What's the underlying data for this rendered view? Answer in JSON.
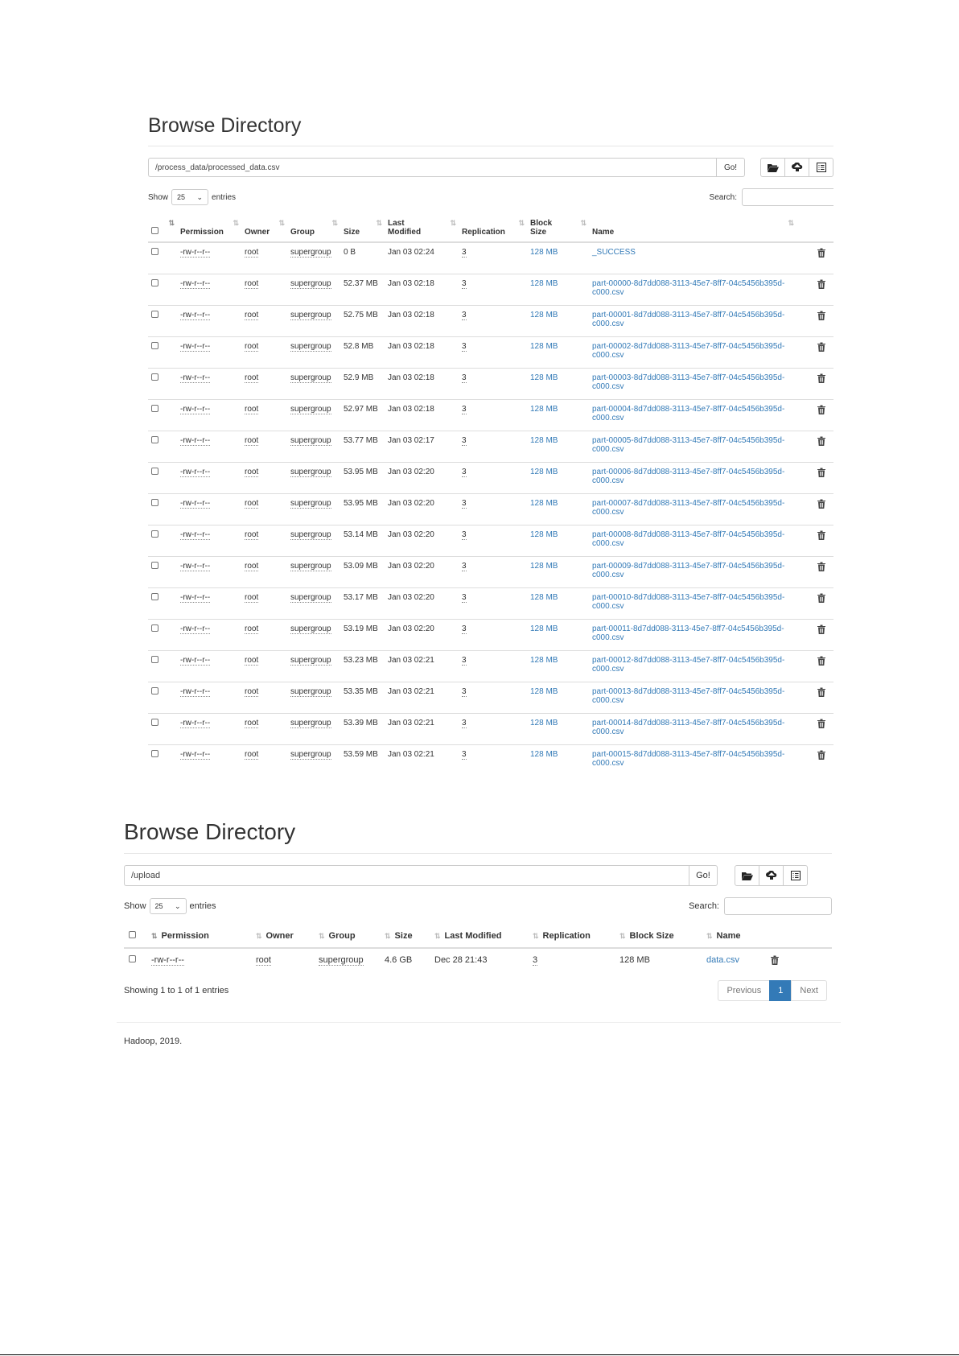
{
  "panel1": {
    "title": "Browse Directory",
    "path": "/process_data/processed_data.csv",
    "go_label": "Go!",
    "show_label": "Show",
    "entries_value": "25",
    "entries_label": "entries",
    "search_label": "Search:",
    "headers": [
      "Permission",
      "Owner",
      "Group",
      "Size",
      "Last Modified",
      "Replication",
      "Block Size",
      "Name"
    ],
    "rows": [
      [
        "-rw-r--r--",
        "root",
        "supergroup",
        "0 B",
        "Jan 03 02:24",
        "3",
        "128 MB",
        "_SUCCESS"
      ],
      [
        "-rw-r--r--",
        "root",
        "supergroup",
        "52.37 MB",
        "Jan 03 02:18",
        "3",
        "128 MB",
        "part-00000-8d7dd088-3113-45e7-8ff7-04c5456b395d-c000.csv"
      ],
      [
        "-rw-r--r--",
        "root",
        "supergroup",
        "52.75 MB",
        "Jan 03 02:18",
        "3",
        "128 MB",
        "part-00001-8d7dd088-3113-45e7-8ff7-04c5456b395d-c000.csv"
      ],
      [
        "-rw-r--r--",
        "root",
        "supergroup",
        "52.8 MB",
        "Jan 03 02:18",
        "3",
        "128 MB",
        "part-00002-8d7dd088-3113-45e7-8ff7-04c5456b395d-c000.csv"
      ],
      [
        "-rw-r--r--",
        "root",
        "supergroup",
        "52.9 MB",
        "Jan 03 02:18",
        "3",
        "128 MB",
        "part-00003-8d7dd088-3113-45e7-8ff7-04c5456b395d-c000.csv"
      ],
      [
        "-rw-r--r--",
        "root",
        "supergroup",
        "52.97 MB",
        "Jan 03 02:18",
        "3",
        "128 MB",
        "part-00004-8d7dd088-3113-45e7-8ff7-04c5456b395d-c000.csv"
      ],
      [
        "-rw-r--r--",
        "root",
        "supergroup",
        "53.77 MB",
        "Jan 03 02:17",
        "3",
        "128 MB",
        "part-00005-8d7dd088-3113-45e7-8ff7-04c5456b395d-c000.csv"
      ],
      [
        "-rw-r--r--",
        "root",
        "supergroup",
        "53.95 MB",
        "Jan 03 02:20",
        "3",
        "128 MB",
        "part-00006-8d7dd088-3113-45e7-8ff7-04c5456b395d-c000.csv"
      ],
      [
        "-rw-r--r--",
        "root",
        "supergroup",
        "53.95 MB",
        "Jan 03 02:20",
        "3",
        "128 MB",
        "part-00007-8d7dd088-3113-45e7-8ff7-04c5456b395d-c000.csv"
      ],
      [
        "-rw-r--r--",
        "root",
        "supergroup",
        "53.14 MB",
        "Jan 03 02:20",
        "3",
        "128 MB",
        "part-00008-8d7dd088-3113-45e7-8ff7-04c5456b395d-c000.csv"
      ],
      [
        "-rw-r--r--",
        "root",
        "supergroup",
        "53.09 MB",
        "Jan 03 02:20",
        "3",
        "128 MB",
        "part-00009-8d7dd088-3113-45e7-8ff7-04c5456b395d-c000.csv"
      ],
      [
        "-rw-r--r--",
        "root",
        "supergroup",
        "53.17 MB",
        "Jan 03 02:20",
        "3",
        "128 MB",
        "part-00010-8d7dd088-3113-45e7-8ff7-04c5456b395d-c000.csv"
      ],
      [
        "-rw-r--r--",
        "root",
        "supergroup",
        "53.19 MB",
        "Jan 03 02:20",
        "3",
        "128 MB",
        "part-00011-8d7dd088-3113-45e7-8ff7-04c5456b395d-c000.csv"
      ],
      [
        "-rw-r--r--",
        "root",
        "supergroup",
        "53.23 MB",
        "Jan 03 02:21",
        "3",
        "128 MB",
        "part-00012-8d7dd088-3113-45e7-8ff7-04c5456b395d-c000.csv"
      ],
      [
        "-rw-r--r--",
        "root",
        "supergroup",
        "53.35 MB",
        "Jan 03 02:21",
        "3",
        "128 MB",
        "part-00013-8d7dd088-3113-45e7-8ff7-04c5456b395d-c000.csv"
      ],
      [
        "-rw-r--r--",
        "root",
        "supergroup",
        "53.39 MB",
        "Jan 03 02:21",
        "3",
        "128 MB",
        "part-00014-8d7dd088-3113-45e7-8ff7-04c5456b395d-c000.csv"
      ],
      [
        "-rw-r--r--",
        "root",
        "supergroup",
        "53.59 MB",
        "Jan 03 02:21",
        "3",
        "128 MB",
        "part-00015-8d7dd088-3113-45e7-8ff7-04c5456b395d-c000.csv"
      ]
    ]
  },
  "panel2": {
    "title": "Browse Directory",
    "path": "/upload",
    "go_label": "Go!",
    "show_label": "Show",
    "entries_value": "25",
    "entries_label": "entries",
    "search_label": "Search:",
    "headers": [
      "Permission",
      "Owner",
      "Group",
      "Size",
      "Last Modified",
      "Replication",
      "Block Size",
      "Name"
    ],
    "rows": [
      [
        "-rw-r--r--",
        "root",
        "supergroup",
        "4.6 GB",
        "Dec 28 21:43",
        "3",
        "128 MB",
        "data.csv"
      ]
    ],
    "showing": "Showing 1 to 1 of 1 entries",
    "pager": {
      "previous": "Previous",
      "current": "1",
      "next": "Next"
    }
  },
  "footer": "Hadoop, 2019.",
  "colors": {
    "link": "#337ab7",
    "active_page": "#337ab7",
    "border": "#dddddd"
  }
}
